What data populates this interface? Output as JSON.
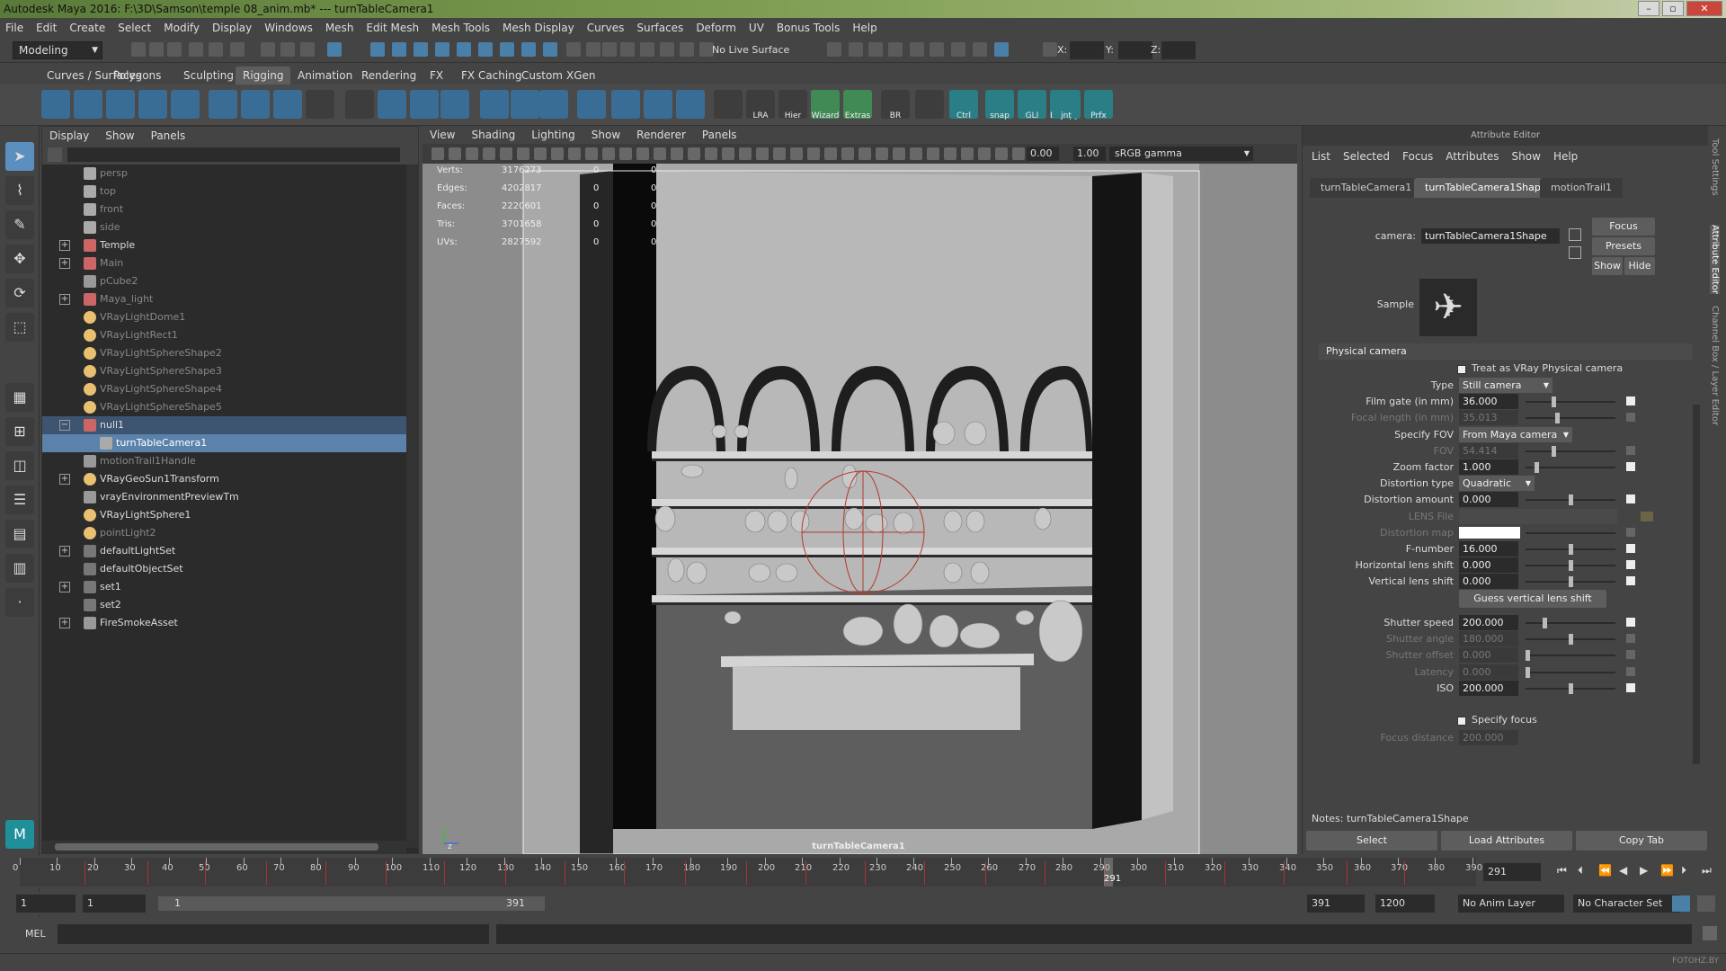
{
  "window": {
    "title": "Autodesk Maya 2016: F:\\3D\\Samson\\temple 08_anim.mb*  ---  turnTableCamera1"
  },
  "menu": [
    "File",
    "Edit",
    "Create",
    "Select",
    "Modify",
    "Display",
    "Windows",
    "Mesh",
    "Edit Mesh",
    "Mesh Tools",
    "Mesh Display",
    "Curves",
    "Surfaces",
    "Deform",
    "UV",
    "Bonus Tools",
    "Help"
  ],
  "status": {
    "mode": "Modeling",
    "live_surface": "No Live Surface",
    "x_label": "X:",
    "y_label": "Y:",
    "z_label": "Z:"
  },
  "shelf_tabs": [
    "Curves / Surfaces",
    "Polygons",
    "Sculpting",
    "Rigging",
    "Animation",
    "Rendering",
    "FX",
    "FX Caching",
    "Custom",
    "XGen"
  ],
  "shelf_active": "Rigging",
  "shelf_labels": [
    "LRA",
    "Hier",
    "Wizard",
    "Extras",
    "BR",
    "Ctrl",
    "snap",
    "GLI",
    "Bscopy",
    "jnt",
    "Prfx"
  ],
  "outliner": {
    "menu": [
      "Display",
      "Show",
      "Panels"
    ],
    "items": [
      {
        "label": "persp",
        "dim": true,
        "exp": false
      },
      {
        "label": "top",
        "dim": true,
        "exp": false
      },
      {
        "label": "front",
        "dim": true,
        "exp": false
      },
      {
        "label": "side",
        "dim": true,
        "exp": false
      },
      {
        "label": "Temple",
        "dim": false,
        "exp": true
      },
      {
        "label": "Main",
        "dim": true,
        "exp": true
      },
      {
        "label": "pCube2",
        "dim": true,
        "exp": false
      },
      {
        "label": "Maya_light",
        "dim": true,
        "exp": true
      },
      {
        "label": "VRayLightDome1",
        "dim": true,
        "exp": false
      },
      {
        "label": "VRayLightRect1",
        "dim": true,
        "exp": false
      },
      {
        "label": "VRayLightSphereShape2",
        "dim": true,
        "exp": false
      },
      {
        "label": "VRayLightSphereShape3",
        "dim": true,
        "exp": false
      },
      {
        "label": "VRayLightSphereShape4",
        "dim": true,
        "exp": false
      },
      {
        "label": "VRayLightSphereShape5",
        "dim": true,
        "exp": false
      },
      {
        "label": "null1",
        "dim": false,
        "exp": true,
        "sel": "parent"
      },
      {
        "label": "turnTableCamera1",
        "dim": false,
        "exp": false,
        "sel": "child"
      },
      {
        "label": "motionTrail1Handle",
        "dim": true,
        "exp": false
      },
      {
        "label": "VRayGeoSun1Transform",
        "dim": false,
        "exp": true
      },
      {
        "label": "vrayEnvironmentPreviewTm",
        "dim": false,
        "exp": false
      },
      {
        "label": "VRayLightSphere1",
        "dim": false,
        "exp": false
      },
      {
        "label": "pointLight2",
        "dim": true,
        "exp": false
      },
      {
        "label": "defaultLightSet",
        "dim": false,
        "exp": true
      },
      {
        "label": "defaultObjectSet",
        "dim": false,
        "exp": false
      },
      {
        "label": "set1",
        "dim": false,
        "exp": true
      },
      {
        "label": "set2",
        "dim": false,
        "exp": false
      },
      {
        "label": "FireSmokeAsset",
        "dim": false,
        "exp": true
      }
    ]
  },
  "viewport": {
    "menu": [
      "View",
      "Shading",
      "Lighting",
      "Show",
      "Renderer",
      "Panels"
    ],
    "num1": "0.00",
    "num2": "1.00",
    "color_space": "sRGB gamma",
    "camera_label": "turnTableCamera1",
    "hud": [
      {
        "k": "Verts:",
        "v": "3176273",
        "a": "0",
        "b": "0"
      },
      {
        "k": "Edges:",
        "v": "4202817",
        "a": "0",
        "b": "0"
      },
      {
        "k": "Faces:",
        "v": "2220601",
        "a": "0",
        "b": "0"
      },
      {
        "k": "Tris:",
        "v": "3701658",
        "a": "0",
        "b": "0"
      },
      {
        "k": "UVs:",
        "v": "2827592",
        "a": "0",
        "b": "0"
      }
    ]
  },
  "attribute_editor": {
    "title": "Attribute Editor",
    "menu": [
      "List",
      "Selected",
      "Focus",
      "Attributes",
      "Show",
      "Help"
    ],
    "tabs": [
      "turnTableCamera1",
      "turnTableCamera1Shape",
      "motionTrail1"
    ],
    "camera_label": "camera:",
    "camera_value": "turnTableCamera1Shape",
    "buttons": {
      "focus": "Focus",
      "presets": "Presets",
      "show": "Show",
      "hide": "Hide"
    },
    "sample_label": "Sample",
    "section": "Physical camera",
    "treat_label": "Treat as VRay Physical camera",
    "rows": [
      {
        "label": "Type",
        "kind": "drop",
        "value": "Still camera",
        "dim": false
      },
      {
        "label": "Film gate (in mm)",
        "kind": "field",
        "value": "36.000",
        "dim": false,
        "slider": 0.3
      },
      {
        "label": "Focal length (in mm)",
        "kind": "field",
        "value": "35.013",
        "dim": true,
        "slider": 0.35
      },
      {
        "label": "Specify FOV",
        "kind": "drop",
        "value": "From Maya camera",
        "dim": false
      },
      {
        "label": "FOV",
        "kind": "field",
        "value": "54.414",
        "dim": true,
        "slider": 0.3
      },
      {
        "label": "Zoom factor",
        "kind": "field",
        "value": "1.000",
        "dim": false,
        "slider": 0.1
      },
      {
        "label": "Distortion type",
        "kind": "drop",
        "value": "Quadratic",
        "dim": false
      },
      {
        "label": "Distortion amount",
        "kind": "field",
        "value": "0.000",
        "dim": false,
        "slider": 0.5
      },
      {
        "label": "LENS File",
        "kind": "file",
        "value": "",
        "dim": true
      },
      {
        "label": "Distortion map",
        "kind": "swatch",
        "value": "",
        "dim": true
      },
      {
        "label": "F-number",
        "kind": "field",
        "value": "16.000",
        "dim": false,
        "slider": 0.5
      },
      {
        "label": "Horizontal lens shift",
        "kind": "field",
        "value": "0.000",
        "dim": false,
        "slider": 0.5
      },
      {
        "label": "Vertical lens shift",
        "kind": "field",
        "value": "0.000",
        "dim": false,
        "slider": 0.5
      }
    ],
    "guess_button": "Guess vertical lens shift",
    "rows2": [
      {
        "label": "Shutter speed",
        "value": "200.000",
        "dim": false,
        "slider": 0.2
      },
      {
        "label": "Shutter angle",
        "value": "180.000",
        "dim": true,
        "slider": 0.5
      },
      {
        "label": "Shutter offset",
        "value": "0.000",
        "dim": true,
        "slider": 0.0
      },
      {
        "label": "Latency",
        "value": "0.000",
        "dim": true,
        "slider": 0.0
      },
      {
        "label": "ISO",
        "value": "200.000",
        "dim": false,
        "slider": 0.5
      }
    ],
    "specify_focus": "Specify focus",
    "focus_distance": {
      "label": "Focus distance",
      "value": "200.000"
    },
    "notes": "Notes:  turnTableCamera1Shape",
    "bottom_buttons": [
      "Select",
      "Load Attributes",
      "Copy Tab"
    ]
  },
  "right_tabs": [
    "Tool Settings",
    "Attribute Editor",
    "Channel Box / Layer Editor"
  ],
  "timeline": {
    "ticks": [
      0,
      10,
      20,
      30,
      40,
      50,
      60,
      70,
      80,
      90,
      100,
      110,
      120,
      130,
      140,
      150,
      160,
      170,
      180,
      190,
      200,
      210,
      220,
      230,
      240,
      250,
      260,
      270,
      280,
      290,
      300,
      310,
      320,
      330,
      340,
      350,
      360,
      370,
      380,
      390
    ],
    "current": "291",
    "current_field": "291"
  },
  "range": {
    "start": "1",
    "start2": "1",
    "slider_start": "1",
    "slider_end": "391",
    "end": "391",
    "end2": "1200",
    "anim_layer": "No Anim Layer",
    "char_set": "No Character Set"
  },
  "cmd": {
    "label": "MEL"
  },
  "watermark": "FOTOHZ.BY"
}
